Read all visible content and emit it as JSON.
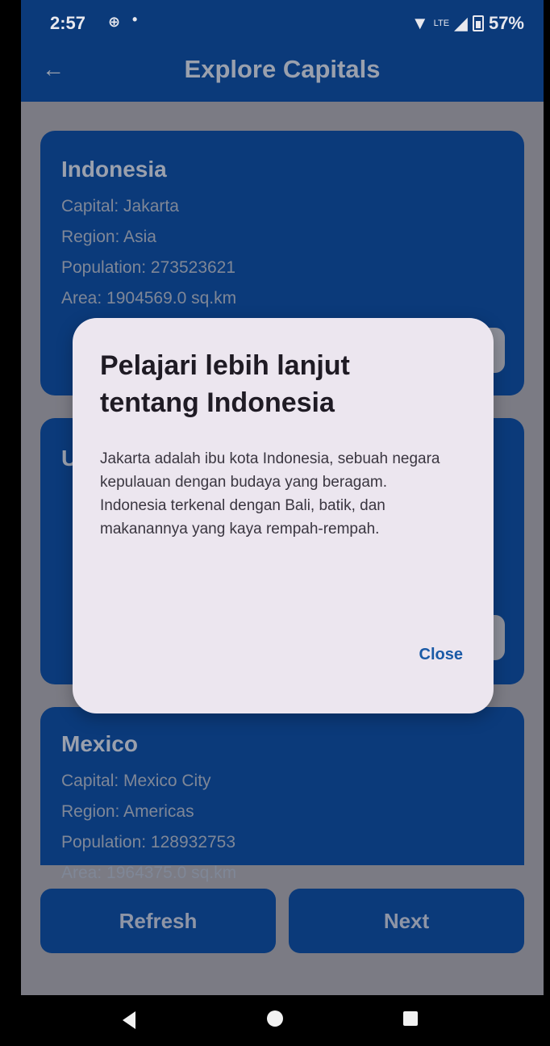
{
  "status_bar": {
    "time": "2:57",
    "left_icons": [
      "⊕",
      "•"
    ],
    "network": "LTE",
    "battery": "57%"
  },
  "app_bar": {
    "title": "Explore Capitals",
    "back_icon": "arrow-left-icon"
  },
  "cards": [
    {
      "name": "Indonesia",
      "capital": "Capital: Jakarta",
      "region": "Region: Asia",
      "population": "Population: 273523621",
      "area": "Area: 1904569.0 sq.km"
    },
    {
      "name": "U"
    },
    {
      "name": "Mexico",
      "capital": "Capital: Mexico City",
      "region": "Region: Americas",
      "population": "Population: 128932753",
      "area": "Area: 1964375.0 sq.km"
    }
  ],
  "bottom_buttons": {
    "refresh": "Refresh",
    "next": "Next"
  },
  "dialog": {
    "title": "Pelajari lebih lanjut tentang Indonesia",
    "body": "Jakarta adalah ibu kota Indonesia, sebuah negara kepulauan dengan budaya yang beragam. Indonesia terkenal dengan Bali, batik, dan makanannya yang kaya rempah-rempah.",
    "close": "Close"
  },
  "nav_bar": {
    "back_icon": "triangle-back-icon",
    "home_icon": "circle-home-icon",
    "recent_icon": "square-recents-icon"
  },
  "colors": {
    "primary": "#0b3a7a",
    "overlay": "#7b7b84",
    "dialog_bg": "#ece6ef",
    "accent": "#1a5aa6"
  }
}
